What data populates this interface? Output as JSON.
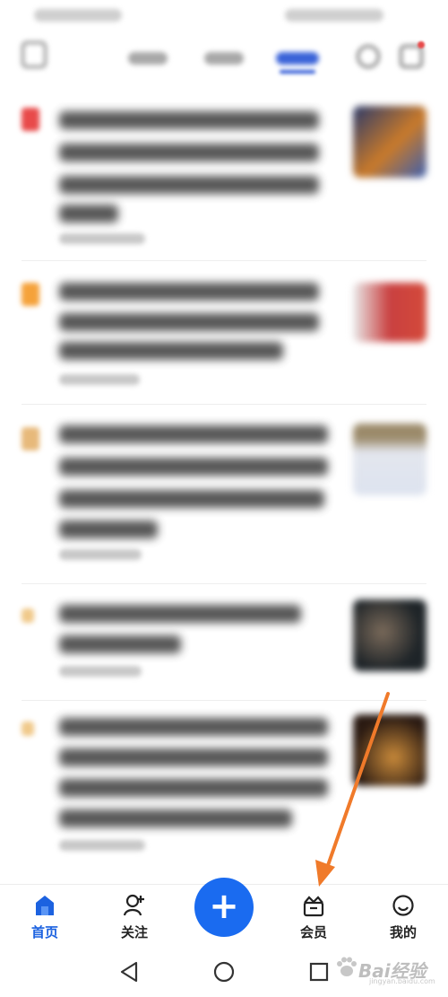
{
  "bottom_nav": {
    "items": [
      {
        "label": "首页",
        "icon": "home-icon",
        "active": true
      },
      {
        "label": "关注",
        "icon": "follow-user-icon",
        "active": false
      },
      {
        "label": "会员",
        "icon": "crown-bag-icon",
        "active": false
      },
      {
        "label": "我的",
        "icon": "smiley-face-icon",
        "active": false
      }
    ],
    "fab_label": "+"
  },
  "system_nav": {
    "back": "back-triangle-icon",
    "home": "home-circle-icon",
    "recents": "recents-square-icon"
  },
  "watermark": {
    "brand": "Bai经验",
    "url": "jingyan.baidu.com"
  },
  "colors": {
    "accent": "#1a6bf0",
    "annotation_arrow": "#f07a2a",
    "rank_1": "#e84a4a",
    "rank_2": "#f5a23a",
    "rank_3": "#e7b97a",
    "rank_other": "#f0c98a"
  },
  "feed": {
    "blurred": true,
    "item_count": 5
  }
}
